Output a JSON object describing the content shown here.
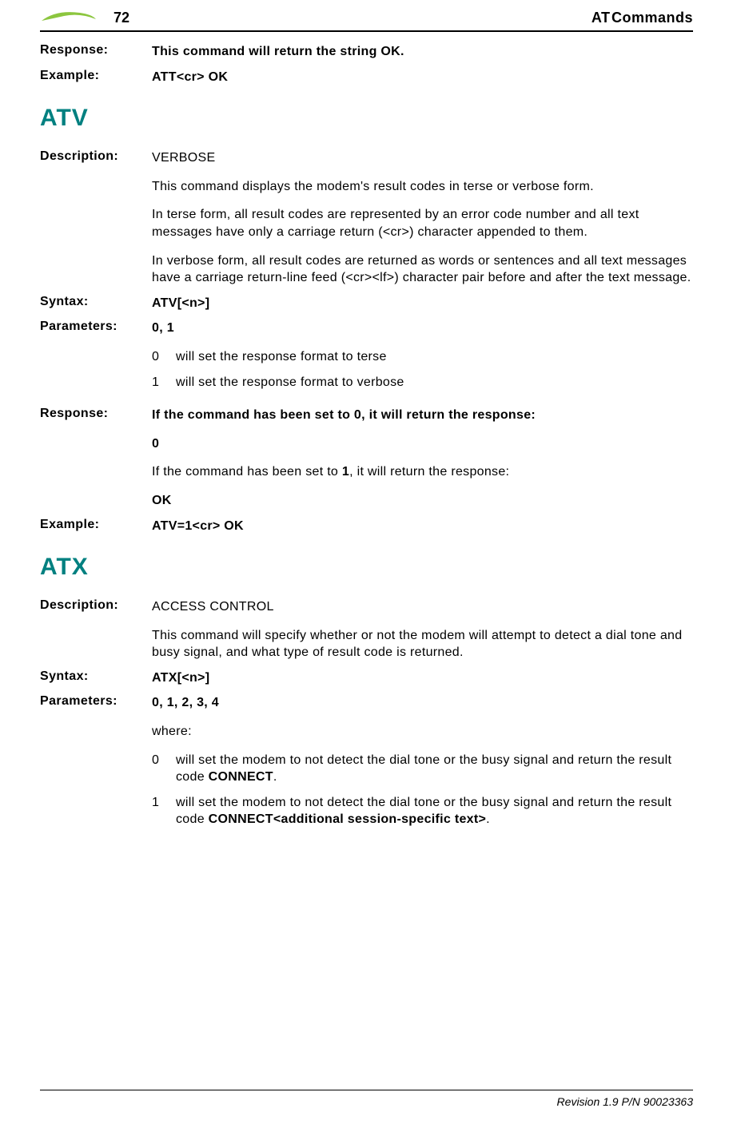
{
  "header": {
    "page_number": "72",
    "chapter_title": "AT Commands"
  },
  "att": {
    "response_label": "Response:",
    "response_value": "This command will return the string OK.",
    "example_label": "Example:",
    "example_value": "ATT<cr> OK"
  },
  "atv": {
    "title": "ATV",
    "description_label": "Description:",
    "description_name": "VERBOSE",
    "description_p1": "This command displays the modem's result codes in terse or verbose form.",
    "description_p2": "In terse form, all result codes are represented by an error code number and all text messages have only a carriage return (<cr>) character appended to them.",
    "description_p3": "In verbose form, all result codes are returned as words or sentences and all text messages have a carriage return-line feed (<cr><lf>) character pair before and after the text message.",
    "syntax_label": "Syntax:",
    "syntax_value": "ATV[<n>]",
    "parameters_label": "Parameters:",
    "parameters_value": "0, 1",
    "param0_num": "0",
    "param0_text": "will set the response format to terse",
    "param1_num": "1",
    "param1_text": "will set the response format to verbose",
    "response_label": "Response:",
    "response_line1": "If the command has been set to 0, it will return the response:",
    "response_line2": "0",
    "response_line3a": "If the command has been set to ",
    "response_line3b": "1",
    "response_line3c": ", it will return the response:",
    "response_line4": "OK",
    "example_label": "Example:",
    "example_value": "ATV=1<cr> OK"
  },
  "atx": {
    "title": "ATX",
    "description_label": "Description:",
    "description_name": "ACCESS CONTROL",
    "description_p1": "This command will specify whether or not the modem will attempt to detect a dial tone and busy signal, and what type of result code is returned.",
    "syntax_label": "Syntax:",
    "syntax_value": "ATX[<n>]",
    "parameters_label": "Parameters:",
    "parameters_value": "0, 1, 2, 3, 4",
    "where_label": "where:",
    "param0_num": "0",
    "param0_a": "will set the modem to not detect the dial tone or the busy signal and return the result code ",
    "param0_b": "CONNECT",
    "param0_c": ".",
    "param1_num": "1",
    "param1_a": "will set the modem to not detect the dial tone or the busy signal and return the result code ",
    "param1_b": "CONNECT<additional session-specific text>",
    "param1_c": "."
  },
  "footer": {
    "text": "Revision 1.9 P/N 90023363"
  }
}
